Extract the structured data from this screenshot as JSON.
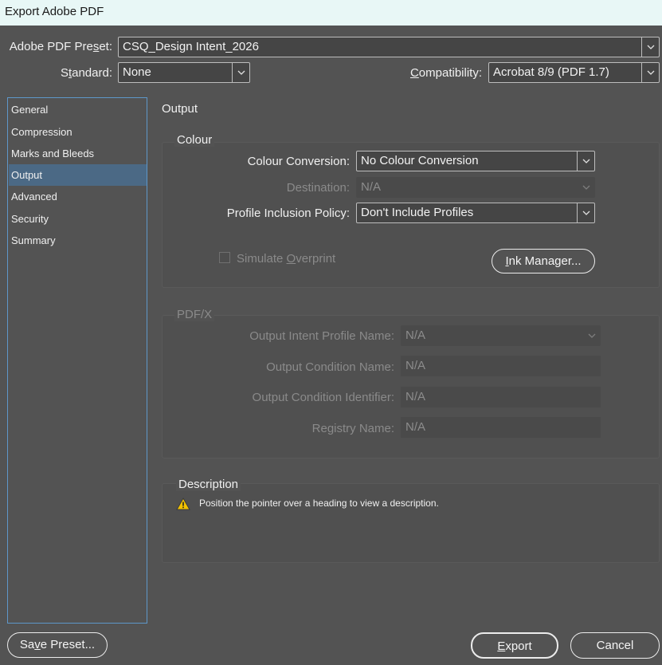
{
  "window": {
    "title": "Export Adobe PDF"
  },
  "header": {
    "preset_label": "Adobe PDF Preset:",
    "preset_value": "CSQ_Design Intent_2026",
    "standard_label": "Standard:",
    "standard_value": "None",
    "compatibility_label": "Compatibility:",
    "compatibility_value": "Acrobat 8/9 (PDF 1.7)"
  },
  "sidebar": {
    "items": [
      {
        "label": "General"
      },
      {
        "label": "Compression"
      },
      {
        "label": "Marks and Bleeds"
      },
      {
        "label": "Output"
      },
      {
        "label": "Advanced"
      },
      {
        "label": "Security"
      },
      {
        "label": "Summary"
      }
    ],
    "active": "Output"
  },
  "main": {
    "section_title": "Output",
    "colour": {
      "title": "Colour",
      "conversion_label": "Colour Conversion:",
      "conversion_value": "No Colour Conversion",
      "destination_label": "Destination:",
      "destination_value": "N/A",
      "profile_label": "Profile Inclusion Policy:",
      "profile_value": "Don't Include Profiles",
      "simulate_overprint_label": "Simulate Overprint",
      "ink_manager_label": "Ink Manager..."
    },
    "pdfx": {
      "title": "PDF/X",
      "intent_label": "Output Intent Profile Name:",
      "intent_value": "N/A",
      "condition_label": "Output Condition Name:",
      "condition_value": "N/A",
      "identifier_label": "Output Condition Identifier:",
      "identifier_value": "N/A",
      "registry_label": "Registry Name:",
      "registry_value": "N/A"
    },
    "description": {
      "title": "Description",
      "text": "Position the pointer over a heading to view a description."
    }
  },
  "footer": {
    "save_preset_label": "Save Preset...",
    "export_label": "Export",
    "cancel_label": "Cancel"
  }
}
